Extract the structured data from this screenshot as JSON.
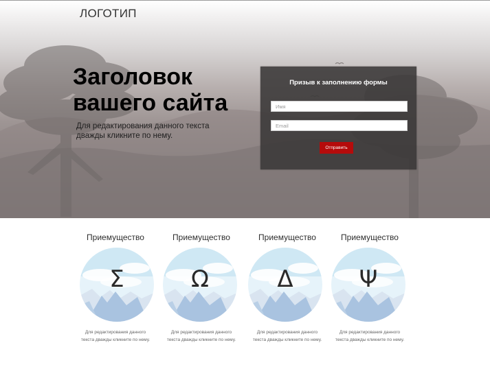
{
  "header": {
    "logo": "ЛОГОТИП"
  },
  "hero": {
    "title": "Заголовок вашего сайта",
    "description": "Для редактирования данного текста дважды кликните по нему."
  },
  "form": {
    "title": "Призыв к заполнению формы",
    "name_placeholder": "Имя",
    "email_placeholder": "Email",
    "submit_label": "Отправить"
  },
  "features": [
    {
      "title": "Приемущество",
      "symbol": "Σ",
      "description": "Для редактирования данного текста дважды кликните по нему."
    },
    {
      "title": "Приемущество",
      "symbol": "Ω",
      "description": "Для редактирования данного текста дважды кликните по нему."
    },
    {
      "title": "Приемущество",
      "symbol": "Δ",
      "description": "Для редактирования данного текста дважды кликните по нему."
    },
    {
      "title": "Приемущество",
      "symbol": "Ψ",
      "description": "Для редактирования данного текста дважды кликните по нему."
    }
  ],
  "colors": {
    "submit_button": "#b50b0b",
    "form_background": "#3a3838",
    "hero_text": "#000000"
  }
}
